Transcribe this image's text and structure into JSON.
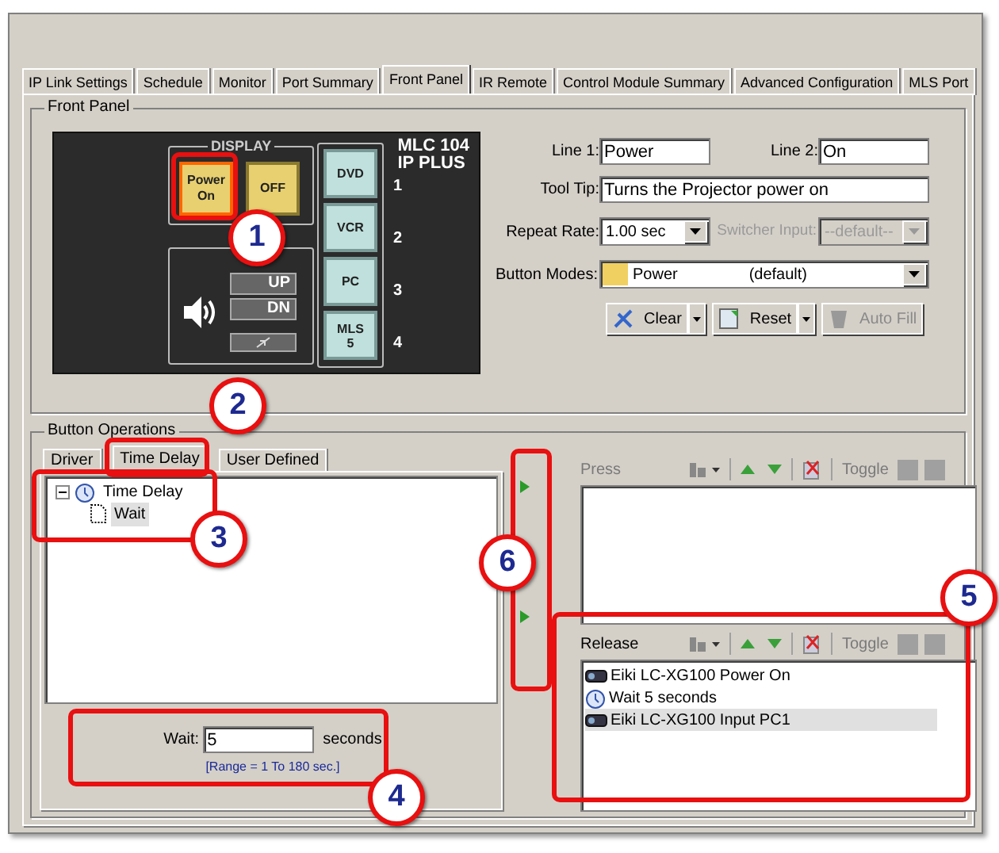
{
  "tabs": [
    {
      "label": "IP Link Settings",
      "selected": false
    },
    {
      "label": "Schedule",
      "selected": false
    },
    {
      "label": "Monitor",
      "selected": false
    },
    {
      "label": "Port Summary",
      "selected": false
    },
    {
      "label": "Front Panel",
      "selected": true
    },
    {
      "label": "IR Remote",
      "selected": false
    },
    {
      "label": "Control Module Summary",
      "selected": false
    },
    {
      "label": "Advanced Configuration",
      "selected": false
    },
    {
      "label": "MLS Port",
      "selected": false
    }
  ],
  "front_panel": {
    "title": "Front Panel",
    "device": {
      "model": [
        "MLC 104",
        "IP PLUS"
      ],
      "display_label": "DISPLAY",
      "display_buttons": [
        {
          "lines": [
            "Power",
            "On"
          ],
          "selected": true
        },
        {
          "lines": [
            "OFF"
          ],
          "selected": false
        }
      ],
      "volume_buttons": [
        "UP",
        "DN"
      ],
      "inputs": [
        {
          "lines": [
            "DVD"
          ],
          "number": "1"
        },
        {
          "lines": [
            "VCR"
          ],
          "number": "2"
        },
        {
          "lines": [
            "PC"
          ],
          "number": "3"
        },
        {
          "lines": [
            "MLS",
            "5"
          ],
          "number": "4"
        }
      ]
    },
    "line1": {
      "label": "Line 1:",
      "value": "Power"
    },
    "line2": {
      "label": "Line 2:",
      "value": "On"
    },
    "tooltip": {
      "label": "Tool Tip:",
      "value": "Turns the Projector power on"
    },
    "repeat_rate": {
      "label": "Repeat Rate:",
      "value": "1.00 sec"
    },
    "switcher_input": {
      "label": "Switcher Input:",
      "value": "--default--",
      "disabled": true
    },
    "button_modes": {
      "label": "Button Modes:",
      "value": "Power",
      "note": "(default)"
    },
    "actions": [
      {
        "label": "Clear",
        "kind": "clear",
        "disabled": false
      },
      {
        "label": "Reset",
        "kind": "reset",
        "disabled": false
      },
      {
        "label": "Auto Fill",
        "kind": "autofill",
        "disabled": true
      }
    ]
  },
  "button_operations": {
    "title": "Button Operations",
    "tabs": [
      {
        "label": "Driver",
        "selected": false
      },
      {
        "label": "Time Delay",
        "selected": true
      },
      {
        "label": "User Defined",
        "selected": false
      }
    ],
    "tree": [
      {
        "label": "Time Delay",
        "expanded": true,
        "selected": false,
        "children": [
          {
            "label": "Wait",
            "selected": true
          }
        ]
      }
    ],
    "wait": {
      "label": "Wait:",
      "value": "5",
      "unit": "seconds",
      "range": "[Range = 1 To 180 sec.]"
    },
    "press": {
      "label": "Press",
      "disabled": true,
      "toggle": "Toggle"
    },
    "release": {
      "label": "Release",
      "disabled": false,
      "toggle": "Toggle",
      "items": [
        {
          "label": "Eiki LC-XG100 Power On",
          "kind": "device",
          "selected": false
        },
        {
          "label": "Wait 5 seconds",
          "kind": "delay",
          "selected": false
        },
        {
          "label": "Eiki LC-XG100 Input PC1",
          "kind": "device",
          "selected": true
        }
      ]
    }
  },
  "callouts": [
    {
      "number": "1"
    },
    {
      "number": "2"
    },
    {
      "number": "3"
    },
    {
      "number": "4"
    },
    {
      "number": "5"
    },
    {
      "number": "6"
    }
  ]
}
